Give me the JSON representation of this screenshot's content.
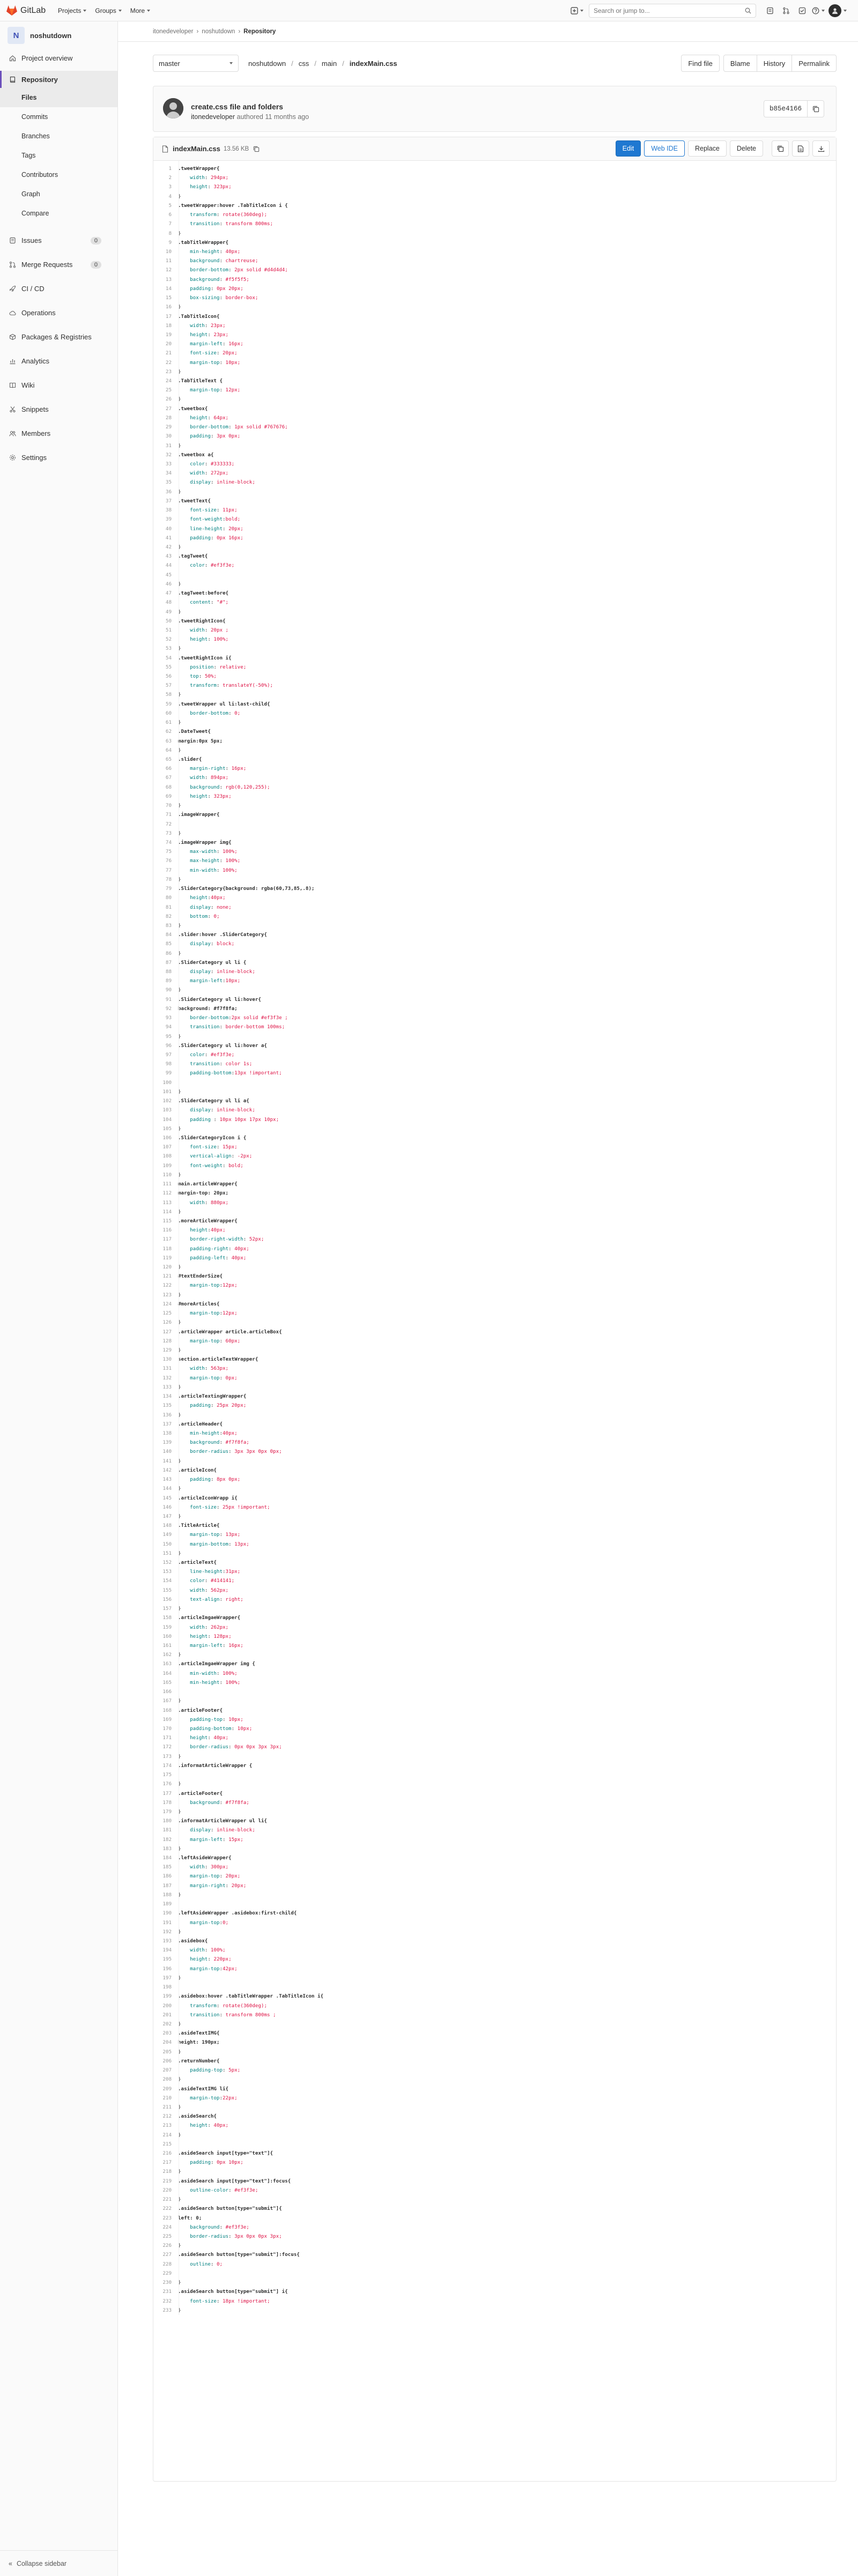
{
  "topbar": {
    "brand": "GitLab",
    "nav": [
      "Projects",
      "Groups",
      "More"
    ],
    "search_placeholder": "Search or jump to..."
  },
  "sidebar": {
    "project_initial": "N",
    "project_name": "noshutdown",
    "items": [
      {
        "label": "Project overview",
        "icon": "home-icon"
      },
      {
        "label": "Repository",
        "icon": "book-icon"
      },
      {
        "label": "Issues",
        "icon": "issues-icon",
        "badge": "0"
      },
      {
        "label": "Merge Requests",
        "icon": "merge-icon",
        "badge": "0"
      },
      {
        "label": "CI / CD",
        "icon": "rocket-icon"
      },
      {
        "label": "Operations",
        "icon": "cloud-gear-icon"
      },
      {
        "label": "Packages & Registries",
        "icon": "package-icon"
      },
      {
        "label": "Analytics",
        "icon": "chart-icon"
      },
      {
        "label": "Wiki",
        "icon": "book-open-icon"
      },
      {
        "label": "Snippets",
        "icon": "snippet-icon"
      },
      {
        "label": "Members",
        "icon": "users-icon"
      },
      {
        "label": "Settings",
        "icon": "gear-icon"
      }
    ],
    "repo_sub": [
      "Files",
      "Commits",
      "Branches",
      "Tags",
      "Contributors",
      "Graph",
      "Compare"
    ],
    "collapse": "Collapse sidebar"
  },
  "breadcrumbs": [
    "itonedeveloper",
    "noshutdown",
    "Repository"
  ],
  "toolbar": {
    "branch": "master",
    "path": [
      "noshutdown",
      "css",
      "main",
      "indexMain.css"
    ],
    "buttons": [
      "Find file",
      "Blame",
      "History",
      "Permalink"
    ]
  },
  "commit": {
    "title": "create.css file and folders",
    "author": "itonedeveloper",
    "meta_rest": "authored 11 months ago",
    "sha": "b85e4166"
  },
  "file": {
    "name": "indexMain.css",
    "size": "13.56 KB",
    "buttons": [
      "Edit",
      "Web IDE",
      "Replace",
      "Delete"
    ]
  },
  "code_lines": [
    ".tweetWrapper{",
    "    width: 294px;",
    "    height: 323px;",
    "}",
    ".tweetWrapper:hover .TabTitleIcon i {",
    "    transform: rotate(360deg);",
    "    transition: transform 800ms;",
    "}",
    ".tabTitleWrapper{",
    "    min-height: 40px;",
    "    background: chartreuse;",
    "    border-bottom: 2px solid #d4d4d4;",
    "    background: #f5f5f5;",
    "    padding: 0px 20px;",
    "    box-sizing: border-box;",
    "}",
    ".TabTitleIcon{",
    "    width: 23px;",
    "    height: 23px;",
    "    margin-left: 16px;",
    "    font-size: 20px;",
    "    margin-top: 10px;",
    "}",
    ".TabTitleText {",
    "    margin-top: 12px;",
    "}",
    ".tweetbox{",
    "    height: 64px;",
    "    border-bottom: 1px solid #767676;",
    "    padding: 3px 0px;",
    "}",
    ".tweetbox a{",
    "    color: #333333;",
    "    width: 272px;",
    "    display: inline-block;",
    "}",
    ".tweetText{",
    "    font-size: 11px;",
    "    font-weight:bold;",
    "    line-height: 20px;",
    "    padding: 0px 16px;",
    "}",
    ".tagTweet{",
    "    color: #ef3f3e;",
    "",
    "}",
    ".tagTweet:before{",
    "    content: \"#\";",
    "}",
    ".tweetRightIcon{",
    "    width: 20px ;",
    "    height: 100%;",
    "}",
    ".tweetRightIcon i{",
    "    position: relative;",
    "    top: 50%;",
    "    transform: translateY(-50%);",
    "}",
    ".tweetWrapper ul li:last-child{",
    "    border-bottom: 0;",
    "}",
    ".DateTweet{",
    "margin:0px 5px;",
    "}",
    ".slider{",
    "    margin-right: 16px;",
    "    width: 894px;",
    "    background: rgb(0,120,255);",
    "    height: 323px;",
    "}",
    ".imageWrapper{",
    "",
    "}",
    ".imageWrapper img{",
    "    max-width: 100%;",
    "    max-height: 100%;",
    "    min-width: 100%;",
    "}",
    ".SliderCategory{background: rgba(60,73,85,.8);",
    "    height:40px;",
    "    display: none;",
    "    bottom: 0;",
    "}",
    ".slider:hover .SliderCategory{",
    "    display: block;",
    "}",
    ".SliderCategory ul li {",
    "    display: inline-block;",
    "    margin-left:10px;",
    "}",
    ".SliderCategory ul li:hover{",
    "background: #f7f8fa;",
    "    border-bottom:2px solid #ef3f3e ;",
    "    transition: border-bottom 100ms;",
    "}",
    ".SliderCategory ul li:hover a{",
    "    color: #ef3f3e;",
    "    transition: color 1s;",
    "    padding-bottom:13px !important;",
    "",
    "}",
    ".SliderCategory ul li a{",
    "    display: inline-block;",
    "    padding : 10px 10px 17px 10px;",
    "}",
    ".SliderCategoryIcon i {",
    "    font-size: 15px;",
    "    vertical-align: -2px;",
    "    font-weight: bold;",
    "}",
    "main.articleWrapper{",
    "margin-top: 20px;",
    "    width: 880px;",
    "}",
    ".moreArticleWrapper{",
    "    height:40px;",
    "    border-right-width: 52px;",
    "    padding-right: 40px;",
    "    padding-left: 40px;",
    "}",
    "#textEnderSize{",
    "    margin-top:12px;",
    "}",
    "#moreArticles{",
    "    margin-top:12px;",
    "}",
    ".articleWrapper article.articleBox{",
    "    margin-top: 60px;",
    "}",
    "section.articleTextWrapper{",
    "    width: 563px;",
    "    margin-top: 0px;",
    "}",
    ".articleTextingWrapper{",
    "    padding: 25px 20px;",
    "}",
    ".articleHeader{",
    "    min-height:40px;",
    "    background: #f7f8fa;",
    "    border-radius: 3px 3px 0px 0px;",
    "}",
    ".articleIcon{",
    "    padding: 8px 0px;",
    "}",
    ".articleIconWrapp i{",
    "    font-size: 25px !important;",
    "}",
    ".TitleArticle{",
    "    margin-top: 13px;",
    "    margin-bottom: 13px;",
    "}",
    ".articleText{",
    "    line-height:31px;",
    "    color: #414141;",
    "    width: 562px;",
    "    text-align: right;",
    "}",
    ".articleImgaeWrapper{",
    "    width: 262px;",
    "    height: 128px;",
    "    margin-left: 16px;",
    "}",
    ".articleImgaeWrapper img {",
    "    min-width: 100%;",
    "    min-height: 100%;",
    "",
    "}",
    ".articleFooter{",
    "    padding-top: 10px;",
    "    padding-bottom: 10px;",
    "    height: 40px;",
    "    border-radius: 0px 0px 3px 3px;",
    "}",
    ".informatArticleWrapper {",
    "",
    "}",
    ".articleFooter{",
    "    background: #f7f8fa;",
    "}",
    ".informatArticleWrapper ul li{",
    "    display: inline-block;",
    "    margin-left: 15px;",
    "}",
    ".leftAsideWrapper{",
    "    width: 300px;",
    "    margin-top: 20px;",
    "    margin-right: 20px;",
    "}",
    "",
    ".leftAsideWrapper .asidebox:first-child{",
    "    margin-top:0;",
    "}",
    ".asidebox{",
    "    width: 100%;",
    "    height: 220px;",
    "    margin-top:42px;",
    "}",
    "",
    ".asidebox:hover .tabTitleWrapper .TabTitleIcon i{",
    "    transform: rotate(360deg);",
    "    transition: transform 800ms ;",
    "}",
    ".asideTextIMG{",
    "height: 190px;",
    "}",
    ".returnNumber{",
    "    padding-top: 5px;",
    "}",
    ".asideTextIMG li{",
    "    margin-top:22px;",
    "}",
    ".asideSearch{",
    "    height: 40px;",
    "}",
    "",
    ".asideSearch input[type=\"text\"]{",
    "    padding: 0px 10px;",
    "}",
    ".asideSearch input[type=\"text\"]:focus{",
    "    outline-color: #ef3f3e;",
    "}",
    ".asideSearch button[type=\"submit\"]{",
    "left: 0;",
    "    background: #ef3f3e;",
    "    border-radius: 3px 0px 0px 3px;",
    "}",
    ".asideSearch button[type=\"submit\"]:focus{",
    "    outline: 0;",
    "",
    "}",
    ".asideSearch button[type=\"submit\"] i{",
    "    font-size: 18px !important;",
    "}"
  ]
}
